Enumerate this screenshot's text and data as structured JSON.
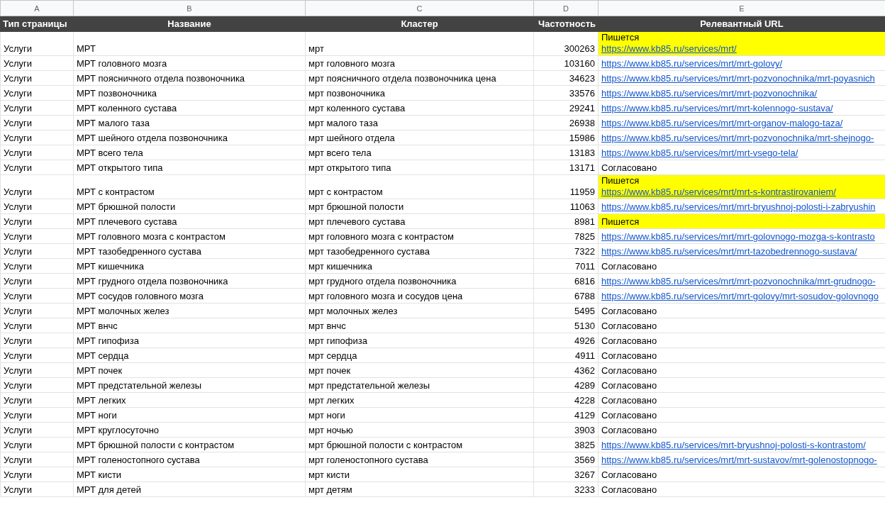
{
  "columns": [
    "A",
    "B",
    "C",
    "D",
    "E"
  ],
  "header": [
    "Тип страницы",
    "Название",
    "Кластер",
    "Частотность",
    "Релевантный URL"
  ],
  "rows": [
    {
      "type": "Услуги",
      "name": "МРТ",
      "cluster": "мрт",
      "frequency": "300263",
      "highlight": true,
      "url": [
        {
          "kind": "text",
          "text": "Пишется"
        },
        {
          "kind": "link",
          "text": "https://www.kb85.ru/services/mrt/"
        }
      ]
    },
    {
      "type": "Услуги",
      "name": "МРТ головного мозга",
      "cluster": "мрт головного мозга",
      "frequency": "103160",
      "highlight": false,
      "url": [
        {
          "kind": "link",
          "text": "https://www.kb85.ru/services/mrt/mrt-golovy/"
        }
      ]
    },
    {
      "type": "Услуги",
      "name": "МРТ поясничного отдела позвоночника",
      "cluster": "мрт поясничного отдела позвоночника цена",
      "frequency": "34623",
      "highlight": false,
      "url": [
        {
          "kind": "link",
          "text": "https://www.kb85.ru/services/mrt/mrt-pozvonochnika/mrt-poyasnich"
        }
      ]
    },
    {
      "type": "Услуги",
      "name": "МРТ позвоночника",
      "cluster": "мрт позвоночника",
      "frequency": "33576",
      "highlight": false,
      "url": [
        {
          "kind": "link",
          "text": "https://www.kb85.ru/services/mrt/mrt-pozvonochnika/"
        }
      ]
    },
    {
      "type": "Услуги",
      "name": "МРТ коленного сустава",
      "cluster": "мрт коленного сустава",
      "frequency": "29241",
      "highlight": false,
      "url": [
        {
          "kind": "link",
          "text": "https://www.kb85.ru/services/mrt/mrt-kolennogo-sustava/"
        }
      ]
    },
    {
      "type": "Услуги",
      "name": "МРТ малого таза",
      "cluster": "мрт малого таза",
      "frequency": "26938",
      "highlight": false,
      "url": [
        {
          "kind": "link",
          "text": "https://www.kb85.ru/services/mrt/mrt-organov-malogo-taza/"
        }
      ]
    },
    {
      "type": "Услуги",
      "name": "МРТ шейного отдела позвоночника",
      "cluster": "мрт шейного отдела",
      "frequency": "15986",
      "highlight": false,
      "url": [
        {
          "kind": "link",
          "text": "https://www.kb85.ru/services/mrt/mrt-pozvonochnika/mrt-shejnogo-"
        }
      ]
    },
    {
      "type": "Услуги",
      "name": "МРТ всего тела",
      "cluster": "мрт всего тела",
      "frequency": "13183",
      "highlight": false,
      "url": [
        {
          "kind": "link",
          "text": "https://www.kb85.ru/services/mrt/mrt-vsego-tela/"
        }
      ]
    },
    {
      "type": "Услуги",
      "name": "МРТ открытого типа",
      "cluster": "мрт открытого типа",
      "frequency": "13171",
      "highlight": false,
      "url": [
        {
          "kind": "text",
          "text": "Согласовано"
        }
      ]
    },
    {
      "type": "Услуги",
      "name": "МРТ с контрастом",
      "cluster": "мрт с контрастом",
      "frequency": "11959",
      "highlight": true,
      "url": [
        {
          "kind": "text",
          "text": "Пишется"
        },
        {
          "kind": "link",
          "text": "https://www.kb85.ru/services/mrt/mrt-s-kontrastirovaniem/"
        }
      ]
    },
    {
      "type": "Услуги",
      "name": "МРТ брюшной полости",
      "cluster": "мрт брюшной полости",
      "frequency": "11063",
      "highlight": false,
      "url": [
        {
          "kind": "link",
          "text": "https://www.kb85.ru/services/mrt/mrt-bryushnoj-polosti-i-zabryushin"
        }
      ]
    },
    {
      "type": "Услуги",
      "name": "МРТ плечевого сустава",
      "cluster": "мрт плечевого сустава",
      "frequency": "8981",
      "highlight": true,
      "url": [
        {
          "kind": "text",
          "text": "Пишется"
        }
      ]
    },
    {
      "type": "Услуги",
      "name": "МРТ головного мозга с контрастом",
      "cluster": "мрт головного мозга с контрастом",
      "frequency": "7825",
      "highlight": false,
      "url": [
        {
          "kind": "link",
          "text": "https://www.kb85.ru/services/mrt/mrt-golovnogo-mozga-s-kontrasto"
        }
      ]
    },
    {
      "type": "Услуги",
      "name": "МРТ тазобедренного сустава",
      "cluster": "мрт тазобедренного сустава",
      "frequency": "7322",
      "highlight": false,
      "url": [
        {
          "kind": "link",
          "text": "https://www.kb85.ru/services/mrt/mrt-tazobedrennogo-sustava/"
        }
      ]
    },
    {
      "type": "Услуги",
      "name": "МРТ кишечника",
      "cluster": "мрт кишечника",
      "frequency": "7011",
      "highlight": false,
      "url": [
        {
          "kind": "text",
          "text": "Согласовано"
        }
      ]
    },
    {
      "type": "Услуги",
      "name": "МРТ грудного отдела позвоночника",
      "cluster": "мрт грудного отдела позвоночника",
      "frequency": "6816",
      "highlight": false,
      "url": [
        {
          "kind": "link",
          "text": "https://www.kb85.ru/services/mrt/mrt-pozvonochnika/mrt-grudnogo-"
        }
      ]
    },
    {
      "type": "Услуги",
      "name": "МРТ сосудов головного мозга",
      "cluster": "мрт головного мозга и сосудов цена",
      "frequency": "6788",
      "highlight": false,
      "url": [
        {
          "kind": "link",
          "text": "https://www.kb85.ru/services/mrt/mrt-golovy/mrt-sosudov-golovnogo"
        }
      ]
    },
    {
      "type": "Услуги",
      "name": "МРТ молочных желез",
      "cluster": "мрт молочных желез",
      "frequency": "5495",
      "highlight": false,
      "url": [
        {
          "kind": "text",
          "text": "Согласовано"
        }
      ]
    },
    {
      "type": "Услуги",
      "name": "МРТ внчс",
      "cluster": "мрт внчс",
      "frequency": "5130",
      "highlight": false,
      "url": [
        {
          "kind": "text",
          "text": "Согласовано"
        }
      ]
    },
    {
      "type": "Услуги",
      "name": "МРТ гипофиза",
      "cluster": "мрт гипофиза",
      "frequency": "4926",
      "highlight": false,
      "url": [
        {
          "kind": "text",
          "text": "Согласовано"
        }
      ]
    },
    {
      "type": "Услуги",
      "name": "МРТ сердца",
      "cluster": "мрт сердца",
      "frequency": "4911",
      "highlight": false,
      "url": [
        {
          "kind": "text",
          "text": "Согласовано"
        }
      ]
    },
    {
      "type": "Услуги",
      "name": "МРТ почек",
      "cluster": "мрт почек",
      "frequency": "4362",
      "highlight": false,
      "url": [
        {
          "kind": "text",
          "text": "Согласовано"
        }
      ]
    },
    {
      "type": "Услуги",
      "name": "МРТ предстательной железы",
      "cluster": "мрт предстательной железы",
      "frequency": "4289",
      "highlight": false,
      "url": [
        {
          "kind": "text",
          "text": "Согласовано"
        }
      ]
    },
    {
      "type": "Услуги",
      "name": "МРТ легких",
      "cluster": "мрт легких",
      "frequency": "4228",
      "highlight": false,
      "url": [
        {
          "kind": "text",
          "text": "Согласовано"
        }
      ]
    },
    {
      "type": "Услуги",
      "name": "МРТ ноги",
      "cluster": "мрт ноги",
      "frequency": "4129",
      "highlight": false,
      "url": [
        {
          "kind": "text",
          "text": "Согласовано"
        }
      ]
    },
    {
      "type": "Услуги",
      "name": "МРТ круглосуточно",
      "cluster": "мрт ночью",
      "frequency": "3903",
      "highlight": false,
      "url": [
        {
          "kind": "text",
          "text": "Согласовано"
        }
      ]
    },
    {
      "type": "Услуги",
      "name": "МРТ брюшной полости с контрастом",
      "cluster": "мрт брюшной полости с контрастом",
      "frequency": "3825",
      "highlight": false,
      "url": [
        {
          "kind": "link",
          "text": "https://www.kb85.ru/services/mrt-bryushnoj-polosti-s-kontrastom/"
        }
      ]
    },
    {
      "type": "Услуги",
      "name": "МРТ голеностопного сустава",
      "cluster": "мрт голеностопного сустава",
      "frequency": "3569",
      "highlight": false,
      "url": [
        {
          "kind": "link",
          "text": "https://www.kb85.ru/services/mrt/mrt-sustavov/mrt-golenostopnogo-"
        }
      ]
    },
    {
      "type": "Услуги",
      "name": "МРТ кисти",
      "cluster": "мрт кисти",
      "frequency": "3267",
      "highlight": false,
      "url": [
        {
          "kind": "text",
          "text": "Согласовано"
        }
      ]
    },
    {
      "type": "Услуги",
      "name": "МРТ для детей",
      "cluster": "мрт детям",
      "frequency": "3233",
      "highlight": false,
      "url": [
        {
          "kind": "text",
          "text": "Согласовано"
        }
      ]
    }
  ]
}
